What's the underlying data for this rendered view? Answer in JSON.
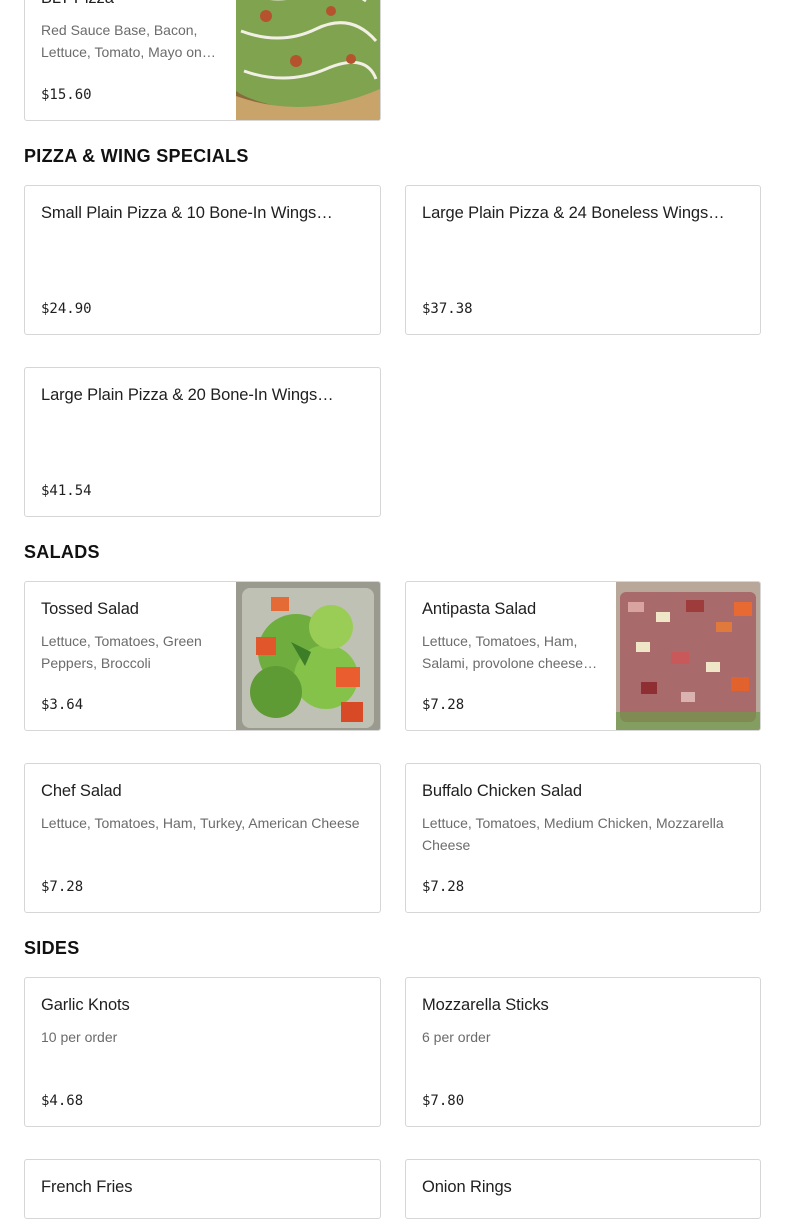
{
  "sections": {
    "top": {
      "items": [
        {
          "name": "BLT Pizza",
          "description": "Red Sauce Base, Bacon, Lettuce, Tomato, Mayo on…",
          "price": "$15.60",
          "image": "pizza-photo"
        }
      ]
    },
    "pizza_wing": {
      "title": "PIZZA & WING SPECIALS",
      "items": [
        {
          "name": "Small Plain Pizza & 10 Bone-In Wings…",
          "price": "$24.90"
        },
        {
          "name": "Large Plain Pizza & 24 Boneless Wings…",
          "price": "$37.38"
        },
        {
          "name": "Large Plain Pizza & 20 Bone-In Wings…",
          "price": "$41.54"
        }
      ]
    },
    "salads": {
      "title": "SALADS",
      "items": [
        {
          "name": "Tossed Salad",
          "description": "Lettuce, Tomatoes, Green Peppers, Broccoli",
          "price": "$3.64",
          "image": "tossed-salad-photo"
        },
        {
          "name": "Antipasta Salad",
          "description": "Lettuce, Tomatoes, Ham, Salami, provolone cheese…",
          "price": "$7.28",
          "image": "antipasta-salad-photo"
        },
        {
          "name": "Chef Salad",
          "description": "Lettuce, Tomatoes, Ham, Turkey, American Cheese",
          "price": "$7.28"
        },
        {
          "name": "Buffalo Chicken Salad",
          "description": "Lettuce, Tomatoes, Medium Chicken, Mozzarella Cheese",
          "price": "$7.28"
        }
      ]
    },
    "sides": {
      "title": "SIDES",
      "items": [
        {
          "name": "Garlic Knots",
          "description": "10 per order",
          "price": "$4.68"
        },
        {
          "name": "Mozzarella Sticks",
          "description": "6 per order",
          "price": "$7.80"
        },
        {
          "name": "French Fries"
        },
        {
          "name": "Onion Rings"
        }
      ]
    }
  }
}
